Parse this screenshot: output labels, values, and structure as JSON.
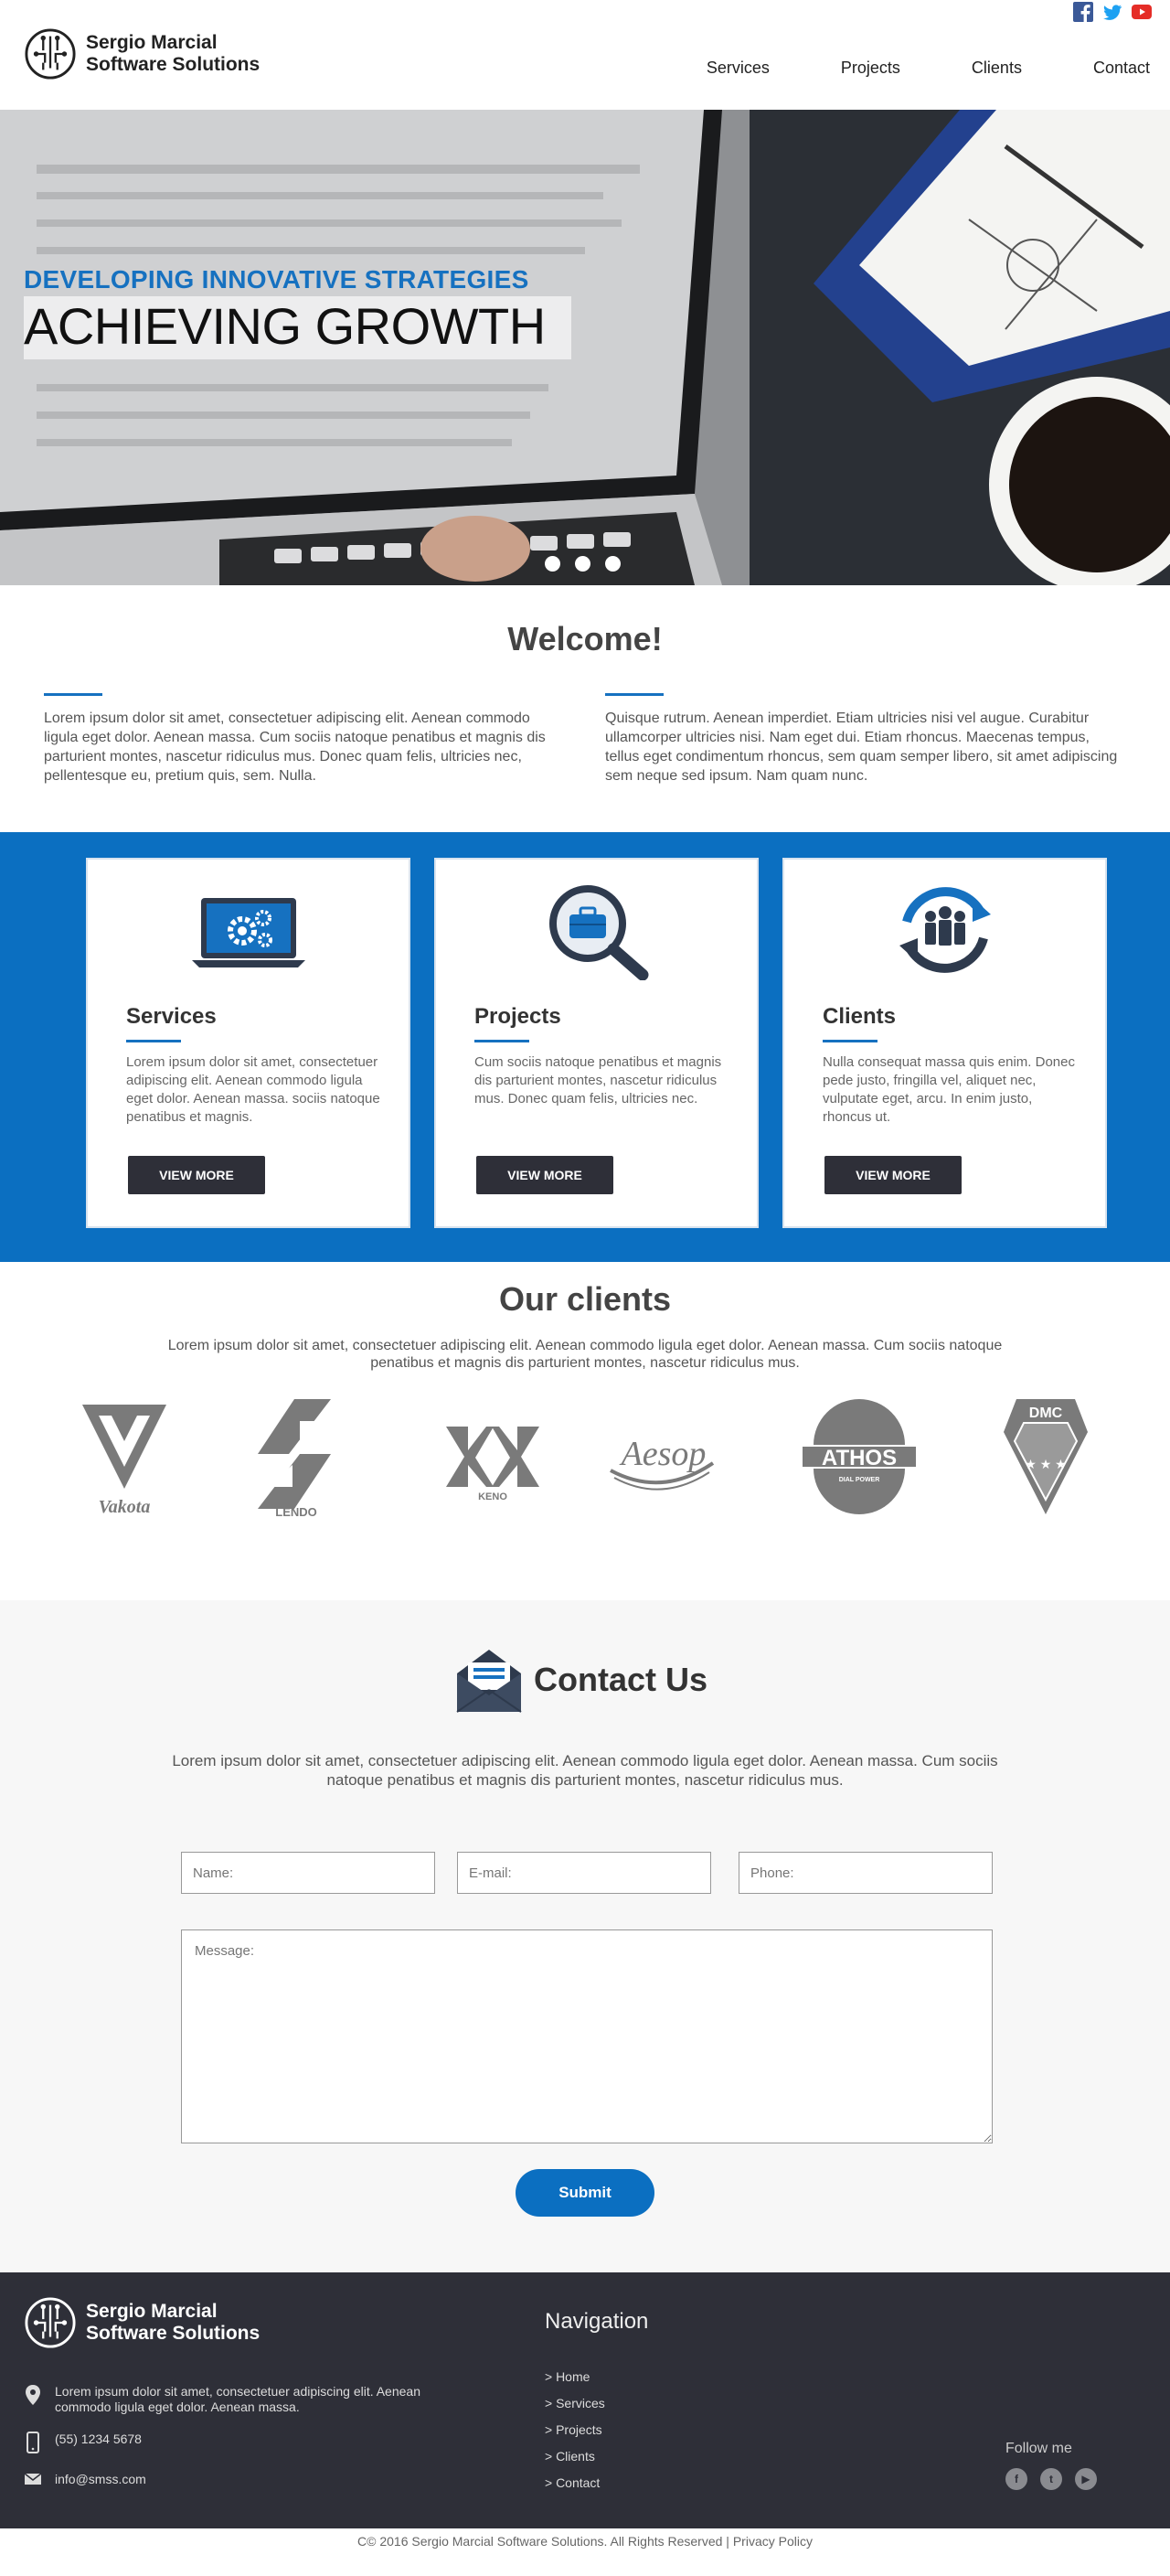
{
  "header": {
    "brand_line1": "Sergio Marcial",
    "brand_line2": "Software Solutions",
    "nav": [
      {
        "label": "Services"
      },
      {
        "label": "Projects"
      },
      {
        "label": "Clients"
      },
      {
        "label": "Contact"
      }
    ],
    "social_icons": [
      "facebook-icon",
      "twitter-icon",
      "youtube-icon"
    ]
  },
  "hero": {
    "subtitle": "DEVELOPING INNOVATIVE STRATEGIES",
    "title": "ACHIEVING GROWTH",
    "slide_count": 3
  },
  "welcome": {
    "title": "Welcome!",
    "col1": "Lorem ipsum dolor sit amet, consectetuer adipiscing elit. Aenean commodo ligula eget dolor. Aenean massa. Cum sociis natoque penatibus et magnis dis parturient montes, nascetur ridiculus mus. Donec quam felis, ultricies nec, pellentesque eu, pretium quis, sem. Nulla.",
    "col2": "Quisque rutrum. Aenean imperdiet. Etiam ultricies nisi vel augue. Curabitur ullamcorper ultricies nisi. Nam eget dui. Etiam rhoncus. Maecenas tempus, tellus eget condimentum rhoncus, sem quam semper libero, sit amet adipiscing sem neque sed ipsum. Nam quam nunc."
  },
  "cards": [
    {
      "title": "Services",
      "text": "Lorem ipsum dolor sit amet, consectetuer adipiscing elit. Aenean commodo ligula eget dolor. Aenean massa. sociis natoque penatibus et magnis.",
      "button": "VIEW MORE",
      "icon": "laptop-gear-icon"
    },
    {
      "title": "Projects",
      "text": "Cum sociis natoque penatibus et magnis dis parturient montes, nascetur ridiculus mus. Donec quam felis, ultricies nec.",
      "button": "VIEW MORE",
      "icon": "magnifier-briefcase-icon"
    },
    {
      "title": "Clients",
      "text": "Nulla consequat massa quis enim. Donec pede justo, fringilla vel, aliquet nec, vulputate eget, arcu. In enim justo, rhoncus ut.",
      "button": "VIEW MORE",
      "icon": "people-cycle-icon"
    }
  ],
  "clients": {
    "title": "Our clients",
    "text": "Lorem ipsum dolor sit amet, consectetuer adipiscing elit. Aenean commodo ligula eget dolor. Aenean massa. Cum sociis natoque penatibus et magnis dis parturient montes, nascetur ridiculus mus.",
    "logos": [
      "Vakota",
      "LENDO",
      "KENO",
      "Aesop",
      "ATHOS",
      "DMC"
    ],
    "athos_tagline": "DIAL POWER"
  },
  "contact": {
    "title": "Contact Us",
    "text": "Lorem ipsum dolor sit amet, consectetuer adipiscing elit. Aenean commodo ligula eget dolor. Aenean massa. Cum sociis natoque penatibus et magnis dis parturient montes, nascetur ridiculus mus.",
    "name_placeholder": "Name:",
    "email_placeholder": "E-mail:",
    "phone_placeholder": "Phone:",
    "message_placeholder": "Message:",
    "submit": "Submit"
  },
  "footer": {
    "brand_line1": "Sergio Marcial",
    "brand_line2": "Software Solutions",
    "address": "Lorem ipsum dolor sit amet, consectetuer adipiscing elit. Aenean commodo ligula eget dolor. Aenean massa.",
    "phone": "(55) 1234 5678",
    "email": "info@smss.com",
    "nav_title": "Navigation",
    "nav": [
      "> Home",
      "> Services",
      "> Projects",
      "> Clients",
      "> Contact"
    ],
    "follow": "Follow me",
    "copyright": "C© 2016 Sergio Marcial Software Solutions. All Rights Reserved | Privacy Policy"
  },
  "colors": {
    "brand_blue": "#0b6fc1",
    "dark": "#2e2f38"
  }
}
